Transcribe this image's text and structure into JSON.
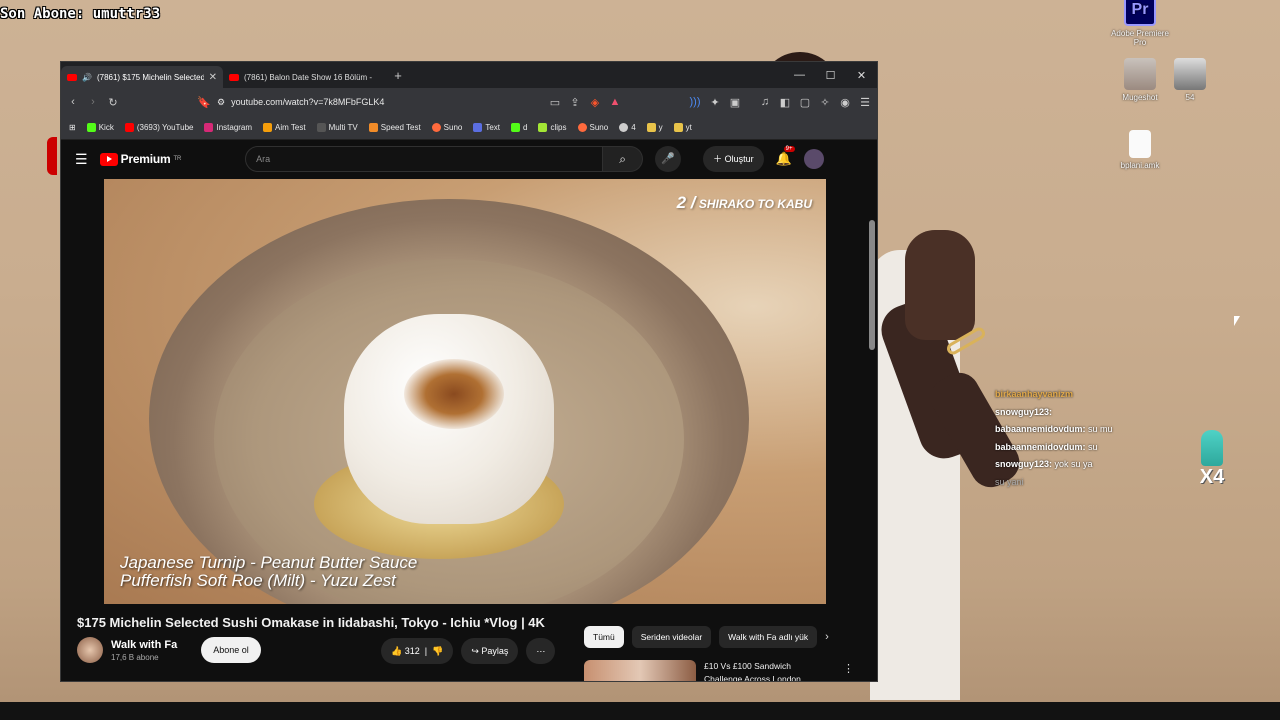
{
  "overlay": {
    "last_sub_label": "Son Abone: umuttr33"
  },
  "desktop_icons": [
    {
      "label": "Adobe Premiere Pro",
      "glyph": "Pr"
    },
    {
      "label": "Mugeshot"
    },
    {
      "label": "54"
    },
    {
      "label": "bplani.amk"
    }
  ],
  "chat": [
    {
      "user": "birkaanhayvanizm",
      "msg": "",
      "color": "#e0a84a"
    },
    {
      "user": "snowguy123:",
      "msg": "",
      "color": "#ffffff"
    },
    {
      "user": "babaannemidovdum:",
      "msg": "su mu",
      "color": "#ffffff"
    },
    {
      "user": "babaannemidovdum:",
      "msg": "su",
      "color": "#ffffff"
    },
    {
      "user": "snowguy123:",
      "msg": "yok su ya",
      "color": "#ffffff"
    },
    {
      "user": "",
      "msg": "su yani",
      "color": "#aaaaaa"
    }
  ],
  "emote_counter": "X4",
  "browser": {
    "tabs": [
      {
        "label": "(7861) $175 Michelin Selected"
      },
      {
        "label": "(7861) Balon Date Show 16 Bölüm -"
      }
    ],
    "url": "youtube.com/watch?v=7k8MFbFGLK4",
    "bookmarks": [
      "Kick",
      "(3693) YouTube",
      "Instagram",
      "Aim Test",
      "Multi TV",
      "Speed Test",
      "Suno",
      "Text",
      "d",
      "clips",
      "Suno",
      "4",
      "y",
      "yt"
    ]
  },
  "youtube": {
    "logo_text": "Premium",
    "region": "TR",
    "search_placeholder": "Ara",
    "create_label": "Oluştur",
    "notif_count": "9+",
    "video_overlay_num": "2 /",
    "video_overlay_text": "SHIRAKO TO KABU",
    "subtitle_line1": "Japanese Turnip - Peanut Butter Sauce",
    "subtitle_line2": "Pufferfish Soft Roe (Milt) - Yuzu Zest",
    "title": "$175 Michelin Selected Sushi Omakase in Iidabashi, Tokyo - Ichiu *Vlog | 4K",
    "channel_name": "Walk with Fa",
    "channel_subs": "17,6 B abone",
    "subscribe_label": "Abone ol",
    "like_count": "312",
    "share_label": "Paylaş",
    "chips": [
      "Tümü",
      "Seriden videolar",
      "Walk with Fa adlı yük"
    ],
    "rec_title": "£10 Vs £100 Sandwich Challenge Across London"
  }
}
